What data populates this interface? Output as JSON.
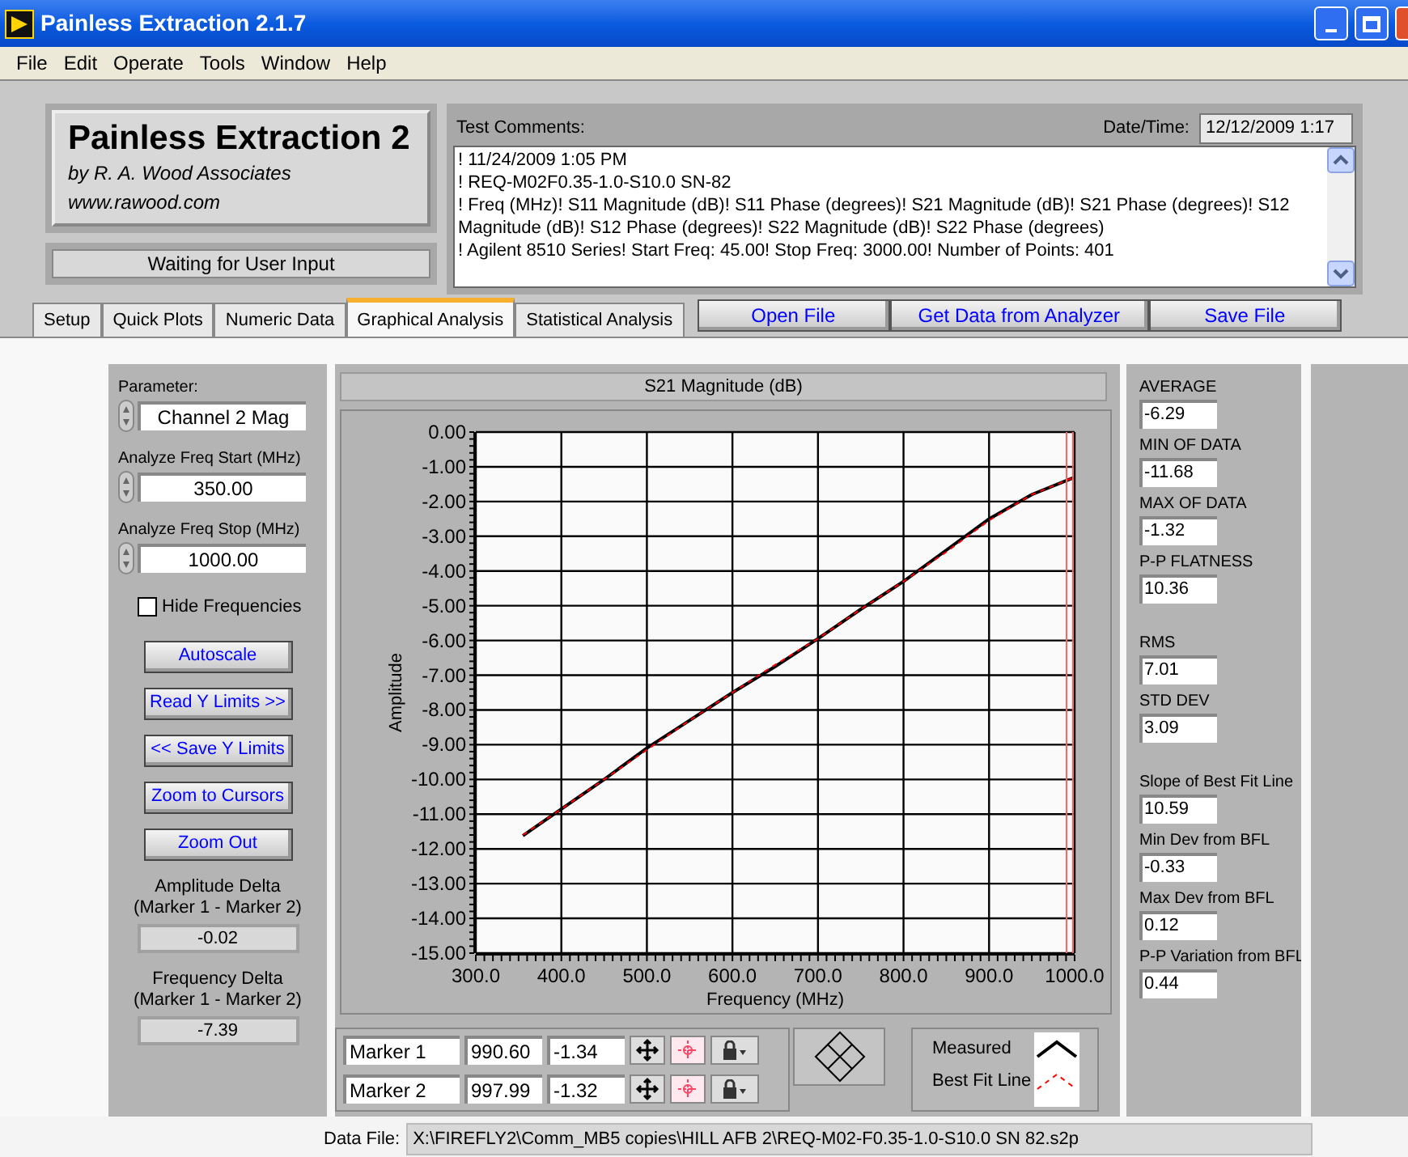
{
  "window": {
    "title": "Painless Extraction 2.1.7"
  },
  "menu": [
    "File",
    "Edit",
    "Operate",
    "Tools",
    "Window",
    "Help"
  ],
  "logo": {
    "title": "Painless Extraction 2",
    "subtitle": "by R. A. Wood Associates",
    "url": "www.rawood.com"
  },
  "status": "Waiting for User Input",
  "test_comments": {
    "label": "Test Comments:",
    "lines": [
      "! 11/24/2009 1:05 PM",
      "! REQ-M02F0.35-1.0-S10.0 SN-82",
      "! Freq (MHz)! S11 Magnitude (dB)! S11 Phase (degrees)! S21 Magnitude (dB)! S21 Phase (degrees)! S12 Magnitude (dB)! S12 Phase (degrees)! S22 Magnitude (dB)! S22 Phase (degrees)",
      "! Agilent 8510 Series! Start Freq: 45.00! Stop Freq: 3000.00! Number of Points: 401"
    ]
  },
  "date_time": {
    "label": "Date/Time:",
    "value": "12/12/2009  1:17"
  },
  "tabs": [
    {
      "label": "Setup",
      "selected": false
    },
    {
      "label": "Quick Plots",
      "selected": false
    },
    {
      "label": "Numeric Data",
      "selected": false
    },
    {
      "label": "Graphical Analysis",
      "selected": true
    },
    {
      "label": "Statistical Analysis",
      "selected": false
    }
  ],
  "action_buttons": [
    "Open File",
    "Get Data from Analyzer",
    "Save File"
  ],
  "controls": [
    {
      "label": "Parameter:",
      "value": "Channel 2 Mag"
    },
    {
      "label": "Analyze Freq Start (MHz)",
      "value": "350.00"
    },
    {
      "label": "Analyze Freq Stop (MHz)",
      "value": "1000.00"
    }
  ],
  "hide_frequencies": {
    "label": "Hide Frequencies",
    "checked": false
  },
  "buttons": [
    "Autoscale",
    "Read Y Limits >>",
    "<< Save Y Limits",
    "Zoom to Cursors",
    "Zoom Out"
  ],
  "deltas": [
    {
      "label": "Amplitude Delta",
      "sublabel": "(Marker 1 - Marker 2)",
      "value": "-0.02"
    },
    {
      "label": "Frequency Delta",
      "sublabel": "(Marker 1 - Marker 2)",
      "value": "-7.39"
    }
  ],
  "chart": {
    "title": "S21 Magnitude (dB)",
    "chart_data": {
      "type": "line",
      "xlabel": "Frequency (MHz)",
      "ylabel": "Amplitude",
      "x": [
        355,
        400,
        450,
        500,
        550,
        600,
        650,
        700,
        750,
        800,
        850,
        900,
        950,
        1000
      ],
      "grid": true,
      "series": [
        {
          "name": "Measured",
          "color": "#000000",
          "line_style": "solid",
          "values": [
            -11.62,
            -10.85,
            -10.0,
            -9.1,
            -8.3,
            -7.5,
            -6.75,
            -5.95,
            -5.1,
            -4.3,
            -3.4,
            -2.5,
            -1.8,
            -1.3
          ]
        },
        {
          "name": "Best Fit Line",
          "color": "#ff0000",
          "line_style": "dashed",
          "values": [
            -11.6,
            -10.85,
            -10.0,
            -9.15,
            -8.3,
            -7.5,
            -6.7,
            -5.95,
            -5.1,
            -4.3,
            -3.45,
            -2.55,
            -1.8,
            -1.3
          ]
        }
      ],
      "xlim": [
        300,
        1000
      ],
      "ylim": [
        -15,
        0
      ],
      "xticks": [
        {
          "value": 300,
          "label": "300.0"
        },
        {
          "value": 400,
          "label": "400.0"
        },
        {
          "value": 500,
          "label": "500.0"
        },
        {
          "value": 600,
          "label": "600.0"
        },
        {
          "value": 700,
          "label": "700.0"
        },
        {
          "value": 800,
          "label": "800.0"
        },
        {
          "value": 900,
          "label": "900.0"
        },
        {
          "value": 1000,
          "label": "1000.0"
        }
      ],
      "yticks": [
        {
          "value": 0,
          "label": "0.00"
        },
        {
          "value": -1,
          "label": "-1.00"
        },
        {
          "value": -2,
          "label": "-2.00"
        },
        {
          "value": -3,
          "label": "-3.00"
        },
        {
          "value": -4,
          "label": "-4.00"
        },
        {
          "value": -5,
          "label": "-5.00"
        },
        {
          "value": -6,
          "label": "-6.00"
        },
        {
          "value": -7,
          "label": "-7.00"
        },
        {
          "value": -8,
          "label": "-8.00"
        },
        {
          "value": -9,
          "label": "-9.00"
        },
        {
          "value": -10,
          "label": "-10.00"
        },
        {
          "value": -11,
          "label": "-11.00"
        },
        {
          "value": -12,
          "label": "-12.00"
        },
        {
          "value": -13,
          "label": "-13.00"
        },
        {
          "value": -14,
          "label": "-14.00"
        },
        {
          "value": -15,
          "label": "-15.00"
        }
      ],
      "ref_lines": [
        {
          "axis": "x",
          "value": 990.6,
          "color": "#ff6060"
        },
        {
          "axis": "x",
          "value": 997.99,
          "color": "#ff6060"
        }
      ]
    }
  },
  "markers": [
    {
      "name": "Marker 1",
      "frequency": "990.60",
      "amplitude": "-1.34"
    },
    {
      "name": "Marker 2",
      "frequency": "997.99",
      "amplitude": "-1.32"
    }
  ],
  "stat_groups": [
    [
      {
        "label": "AVERAGE",
        "value": "-6.29"
      },
      {
        "label": "MIN OF DATA",
        "value": "-11.68"
      },
      {
        "label": "MAX OF DATA",
        "value": "-1.32"
      },
      {
        "label": "P-P FLATNESS",
        "value": "10.36"
      }
    ],
    [
      {
        "label": "RMS",
        "value": "7.01"
      },
      {
        "label": "STD DEV",
        "value": "3.09"
      }
    ],
    [
      {
        "label": "Slope of Best Fit Line",
        "value": "10.59"
      },
      {
        "label": "Min Dev from BFL",
        "value": "-0.33"
      },
      {
        "label": "Max Dev from BFL",
        "value": "0.12"
      },
      {
        "label": "P-P Variation from BFL",
        "value": "0.44"
      }
    ]
  ],
  "data_file": {
    "label": "Data File:",
    "path": "X:\\FIREFLY2\\Comm_MB5 copies\\HILL AFB 2\\REQ-M02-F0.35-1.0-S10.0 SN 82.s2p"
  }
}
